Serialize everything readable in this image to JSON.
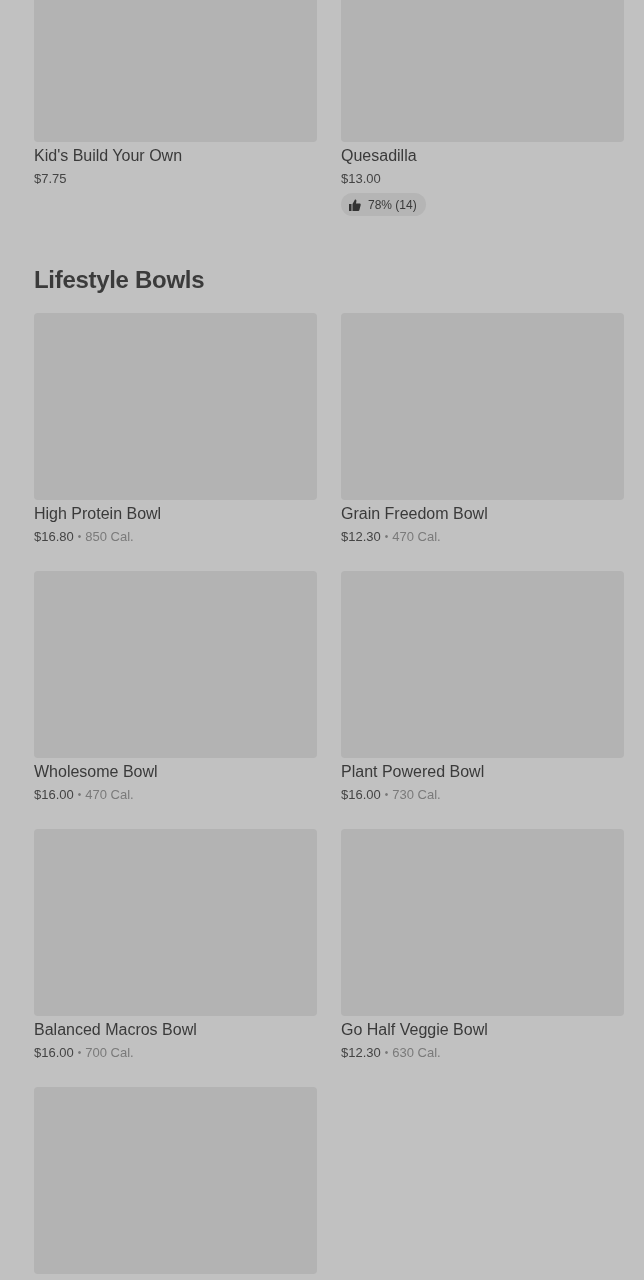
{
  "sections": [
    {
      "items": [
        {
          "kind": "item",
          "name": "Kid's Build Your Own",
          "price": "$7.75"
        },
        {
          "kind": "item",
          "name": "Quesadilla",
          "price": "$13.00",
          "rating": "78% (14)"
        }
      ]
    },
    {
      "title": "Lifestyle Bowls",
      "items": [
        {
          "kind": "item",
          "name": "High Protein Bowl",
          "price": "$16.80",
          "separator": "•",
          "calories": "850 Cal."
        },
        {
          "kind": "item",
          "name": "Grain Freedom Bowl",
          "price": "$12.30",
          "separator": "•",
          "calories": "470 Cal."
        },
        {
          "kind": "item",
          "name": "Wholesome Bowl",
          "price": "$16.00",
          "separator": "•",
          "calories": "470 Cal."
        },
        {
          "kind": "item",
          "name": "Plant Powered Bowl",
          "price": "$16.00",
          "separator": "•",
          "calories": "730 Cal."
        },
        {
          "kind": "item",
          "name": "Balanced Macros Bowl",
          "price": "$16.00",
          "separator": "•",
          "calories": "700 Cal."
        },
        {
          "kind": "item",
          "name": "Go Half Veggie Bowl",
          "price": "$12.30",
          "separator": "•",
          "calories": "630 Cal."
        },
        {
          "kind": "image_only"
        }
      ]
    }
  ]
}
